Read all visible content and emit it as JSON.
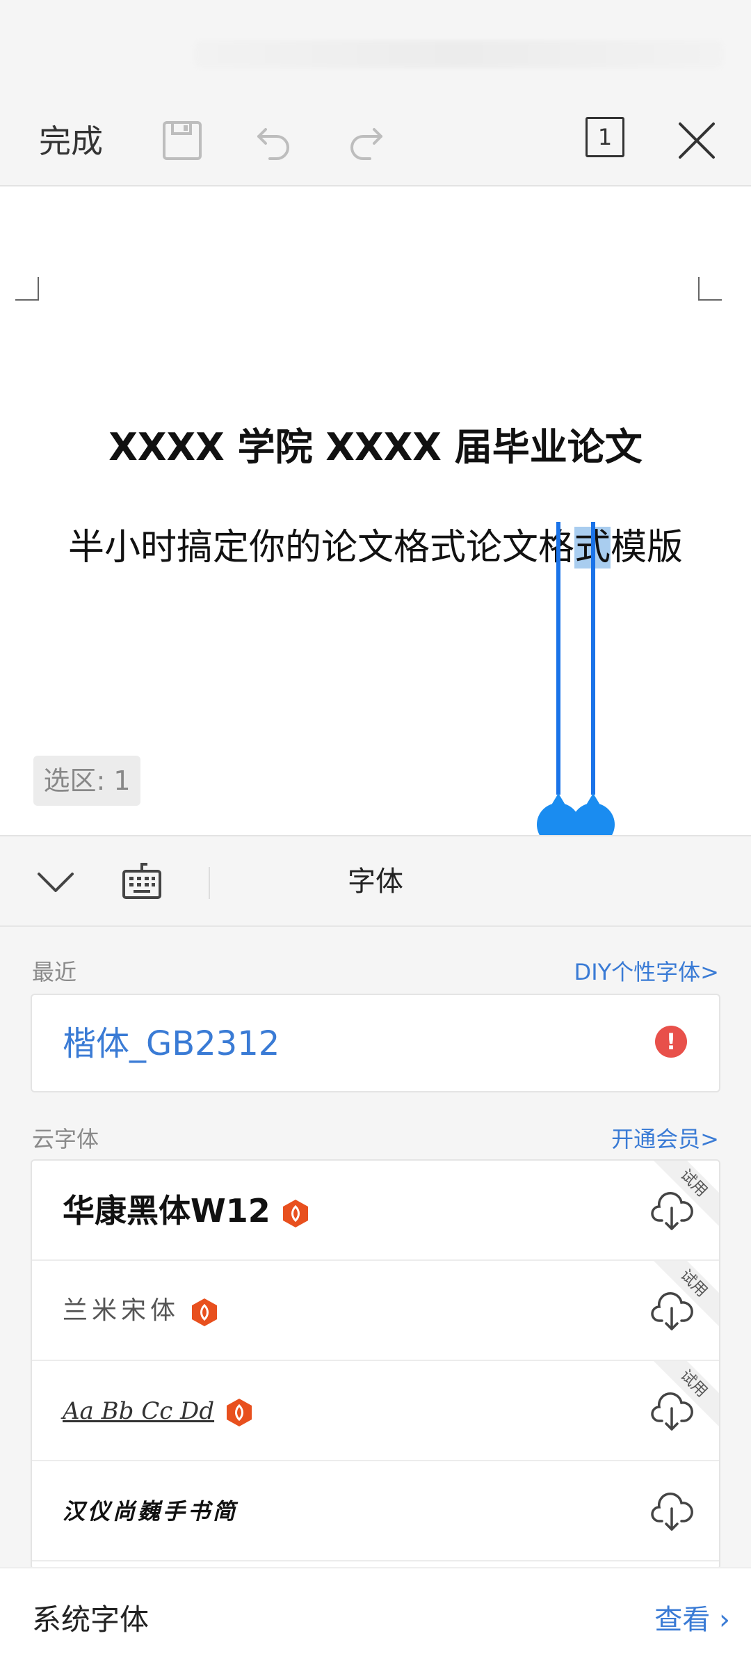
{
  "toolbar": {
    "done_label": "完成",
    "page_count": "1"
  },
  "document": {
    "title": "XXXX 学院 XXXX 届毕业论文",
    "subtitle_before": "半小时搞定你的论文格式论文格",
    "subtitle_selected": "式",
    "subtitle_after": "模版",
    "selection_badge": "选区: 1"
  },
  "panel": {
    "title": "字体"
  },
  "recent": {
    "label": "最近",
    "link": "DIY个性字体>",
    "font_name": "楷体_GB2312"
  },
  "cloud": {
    "label": "云字体",
    "link": "开通会员>",
    "fonts": [
      {
        "name": "华康黑体W12",
        "vip": true,
        "trial": "试用"
      },
      {
        "name": "兰米宋体",
        "vip": true,
        "trial": "试用"
      },
      {
        "name": "Aa Bb Cc Dd",
        "vip": true,
        "trial": "试用"
      },
      {
        "name": "汉仪尚巍手书简",
        "vip": false,
        "trial": ""
      }
    ]
  },
  "system": {
    "label": "系统字体",
    "link": "查看"
  },
  "colors": {
    "accent": "#3a7bd5",
    "selection_handle": "#1a8cf0",
    "warning": "#e8504a",
    "vip_badge": "#e8501e"
  }
}
